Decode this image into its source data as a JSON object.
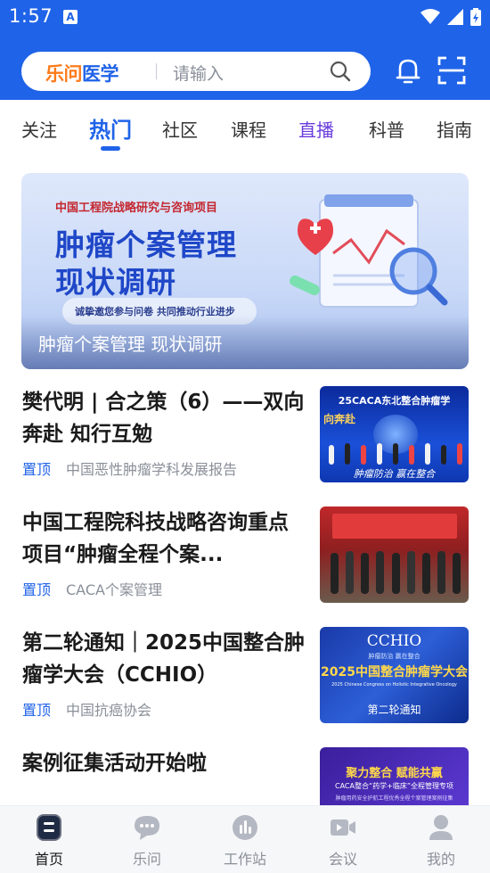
{
  "status_bar": {
    "time": "1:57",
    "notif_letter": "A"
  },
  "search": {
    "logo_le": "乐问",
    "logo_rest": "医学",
    "placeholder": "请输入"
  },
  "tabs": [
    {
      "label": "关注"
    },
    {
      "label": "热门"
    },
    {
      "label": "社区"
    },
    {
      "label": "课程"
    },
    {
      "label": "直播"
    },
    {
      "label": "科普"
    },
    {
      "label": "指南"
    }
  ],
  "banner": {
    "subtitle": "中国工程院战略研究与咨询项目",
    "title_line1": "肿瘤个案管理",
    "title_line2": "现状调研",
    "pill_text": "诚挚邀您参与问卷 共同推动行业进步",
    "caption": "肿瘤个案管理 现状调研"
  },
  "articles": [
    {
      "title": "樊代明 | 合之策（6）——双向奔赴 知行互勉",
      "tag": "置顶",
      "source": "中国恶性肿瘤学科发展报告",
      "thumb_text_top": "25CACA东北整合肿瘤学",
      "thumb_text_side": "向奔赴",
      "thumb_text_bottom": "肿瘤防治  赢在整合"
    },
    {
      "title": "中国工程院科技战略咨询重点项目“肿瘤全程个案...",
      "tag": "置顶",
      "source": "CACA个案管理"
    },
    {
      "title": "第二轮通知｜2025中国整合肿瘤学大会（CCHIO）",
      "tag": "置顶",
      "source": "中国抗癌协会",
      "thumb_logo": "CCHIO",
      "thumb_logo_sub": "肿瘤防治  赢在整合",
      "thumb_title": "2025中国整合肿瘤学大会",
      "thumb_en": "2025 Chinese Congress on Holistic Integrative Oncology",
      "thumb_notice": "第二轮通知"
    },
    {
      "title": "案例征集活动开始啦",
      "thumb_title": "聚力整合 赋能共赢",
      "thumb_line2": "CACA整合“药学+临床”全程管理专项",
      "thumb_line3": "肿瘤用药安全护航工程优秀全程个案管理案例征集"
    }
  ],
  "bottom_nav": [
    {
      "label": "首页",
      "icon": "home-icon"
    },
    {
      "label": "乐问",
      "icon": "chat-bubble-icon"
    },
    {
      "label": "工作站",
      "icon": "workstation-icon"
    },
    {
      "label": "会议",
      "icon": "video-camera-icon"
    },
    {
      "label": "我的",
      "icon": "person-icon"
    }
  ],
  "colors": {
    "primary": "#1f63e8",
    "live_tab": "#6a3cdd",
    "logo_orange": "#ff7a1a"
  }
}
